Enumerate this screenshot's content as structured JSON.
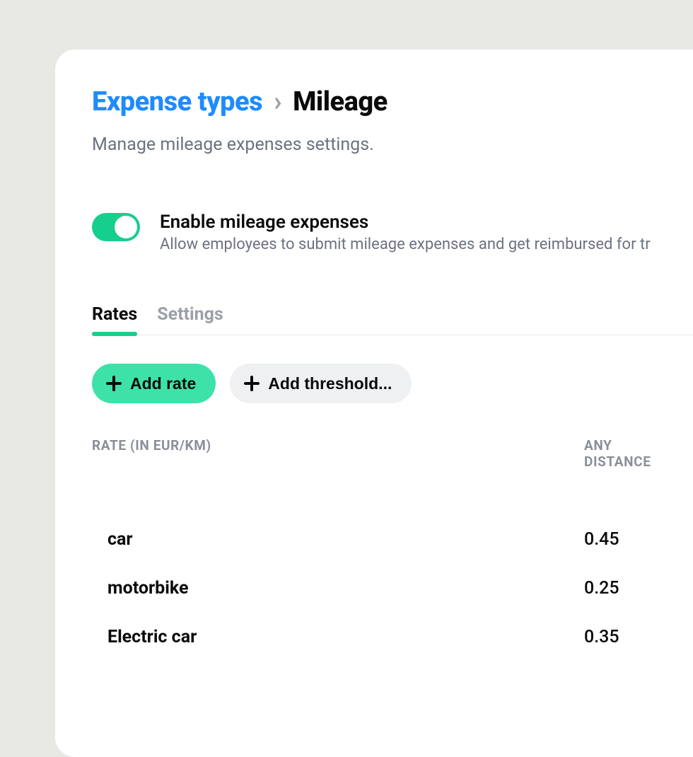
{
  "breadcrumb": {
    "parent": "Expense types",
    "current": "Mileage"
  },
  "subhead": "Manage mileage expenses settings.",
  "enable": {
    "title": "Enable mileage expenses",
    "description": "Allow employees to submit mileage expenses and get reimbursed for tr",
    "on": true
  },
  "tabs": [
    {
      "label": "Rates",
      "active": true
    },
    {
      "label": "Settings",
      "active": false
    }
  ],
  "actions": {
    "add_rate": "Add rate",
    "add_threshold": "Add threshold..."
  },
  "table": {
    "headers": {
      "rate": "RATE (IN EUR/KM)",
      "distance_line1": "ANY",
      "distance_line2": "DISTANCE"
    },
    "rows": [
      {
        "name": "car",
        "value": "0.45"
      },
      {
        "name": "motorbike",
        "value": "0.25"
      },
      {
        "name": "Electric car",
        "value": "0.35"
      }
    ]
  }
}
